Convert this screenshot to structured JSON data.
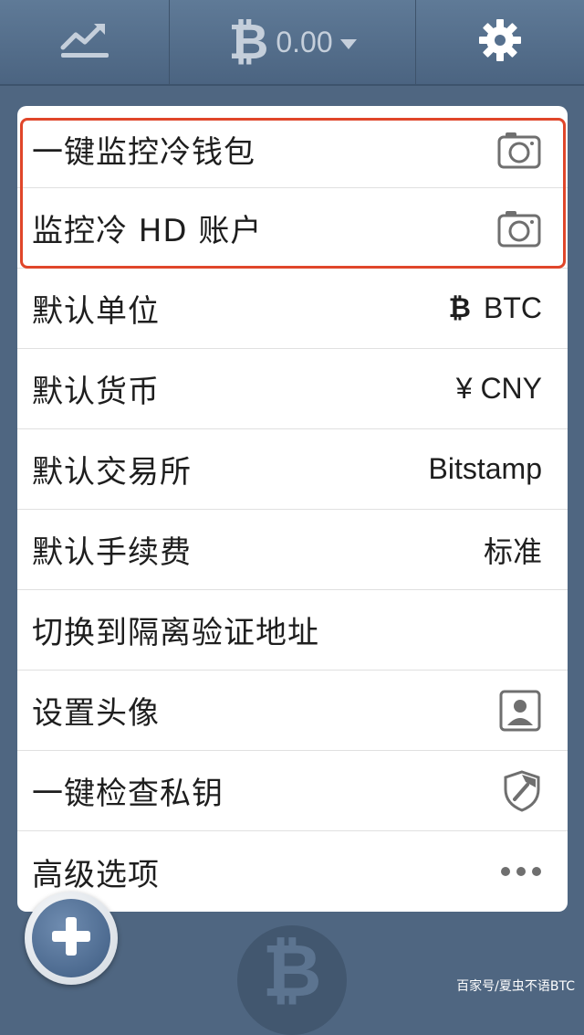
{
  "topbar": {
    "btc_symbol": "₿",
    "balance": "0.00",
    "chart_icon": "chart-trend-icon",
    "settings_icon": "gear-icon"
  },
  "menu": {
    "items": [
      {
        "label": "一键监控冷钱包",
        "value": "",
        "icon": "camera-icon"
      },
      {
        "label": "监控冷 HD 账户",
        "value": "",
        "icon": "camera-icon"
      },
      {
        "label": "默认单位",
        "value": "BTC",
        "symbol": "₿"
      },
      {
        "label": "默认货币",
        "value": "¥ CNY"
      },
      {
        "label": "默认交易所",
        "value": "Bitstamp"
      },
      {
        "label": "默认手续费",
        "value": "标准"
      },
      {
        "label": "切换到隔离验证地址",
        "value": ""
      },
      {
        "label": "设置头像",
        "value": "",
        "icon": "avatar-frame-icon"
      },
      {
        "label": "一键检查私钥",
        "value": "",
        "icon": "shield-icon"
      },
      {
        "label": "高级选项",
        "value": "",
        "icon": "more-dots-icon"
      }
    ]
  },
  "bottom": {
    "logo_symbol": "₿"
  },
  "watermark": "百家号/夏虫不语BTC",
  "colors": {
    "background": "#4f6681",
    "highlight": "#e0462a",
    "card": "#ffffff"
  }
}
